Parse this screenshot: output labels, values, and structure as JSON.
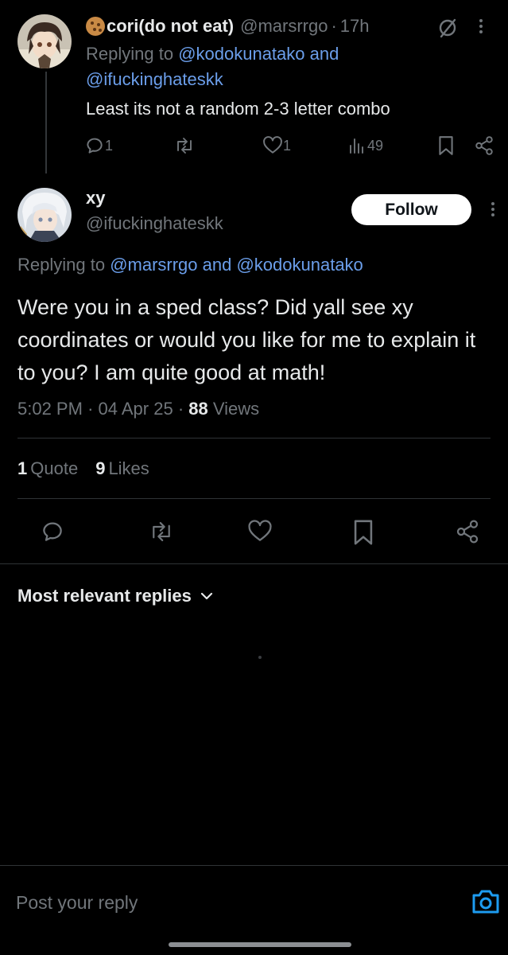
{
  "parent_reply": {
    "display_name": "cori(do not eat)",
    "handle": "@marsrrgo",
    "separator": "·",
    "time": "17h",
    "replying_to_label": "Replying to ",
    "replying_to_1": "@kodokunatako",
    "replying_and": " and",
    "replying_to_2": "@ifuckinghateskk",
    "text": "Least its not a random 2-3 letter combo",
    "reply_count": "1",
    "like_count": "1",
    "view_count": "49"
  },
  "main_tweet": {
    "display_name": "xy",
    "handle": "@ifuckinghateskk",
    "follow_label": "Follow",
    "replying_to_label": "Replying to ",
    "replying_to_1": "@marsrrgo",
    "replying_and": " and ",
    "replying_to_2": "@kodokunatako",
    "text": "Were you in a sped class? Did yall see xy coordinates or would you like for me to explain it to you? I am quite good at math!",
    "time": "5:02 PM",
    "separator": "·",
    "date": "04 Apr 25",
    "view_count": "88",
    "views_label": "Views",
    "quote_count": "1",
    "quote_label": "Quote",
    "like_count": "9",
    "like_label": "Likes"
  },
  "replies_sort": {
    "label": "Most relevant replies"
  },
  "composer": {
    "placeholder": "Post your reply"
  },
  "colors": {
    "background": "#000000",
    "primary_text": "#e7e9ea",
    "secondary_text": "#71767b",
    "link": "#6b9eea",
    "divider": "#2f3336"
  }
}
